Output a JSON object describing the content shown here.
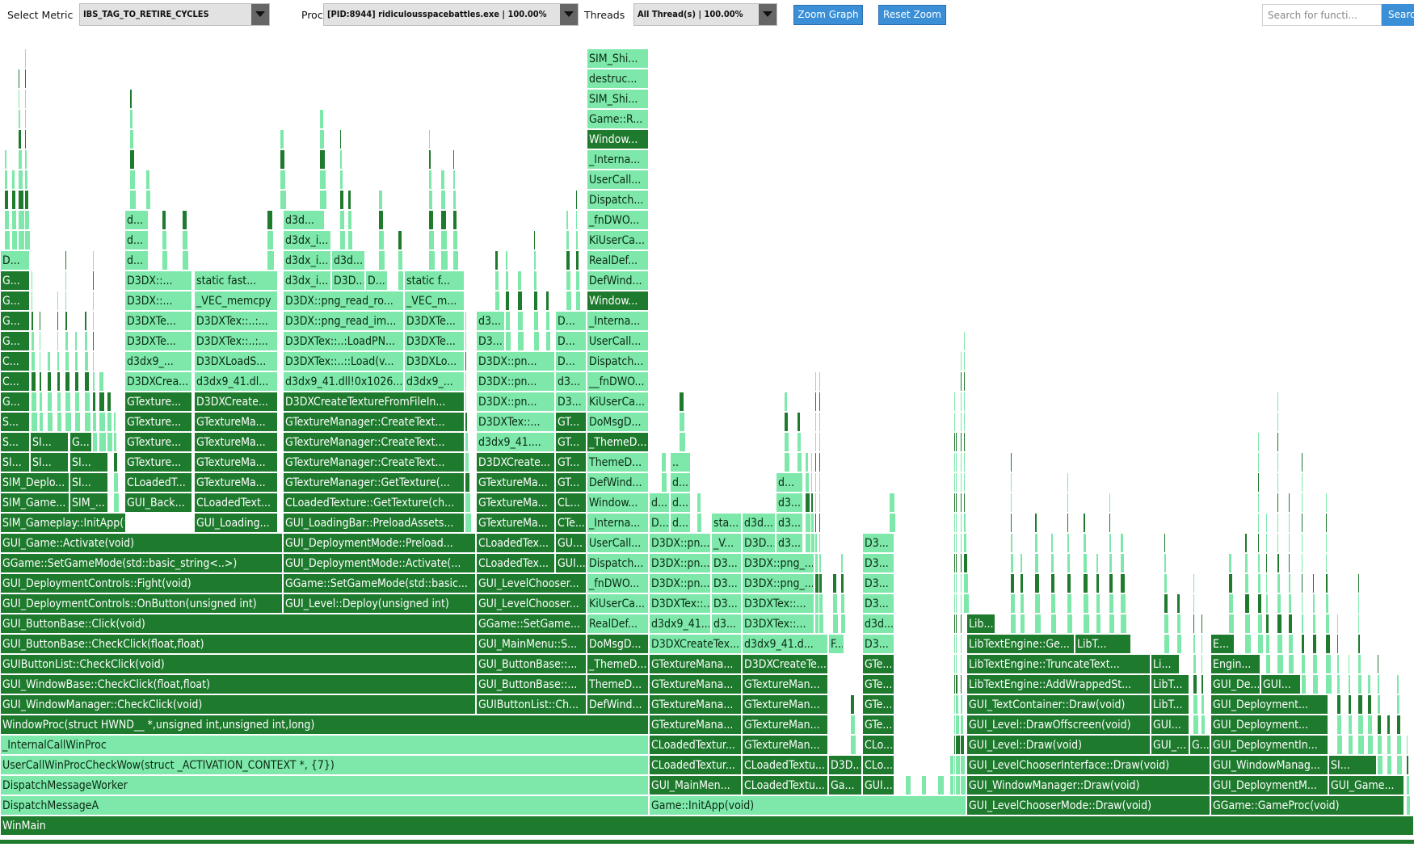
{
  "toolbar": {
    "metric_label": "Select Metric",
    "metric_value": "IBS_TAG_TO_RETIRE_CYCLES",
    "process_label": "Process",
    "process_value": "[PID:8944] ridiculousspacebattles.exe | 100.00%",
    "threads_label": "Threads",
    "threads_value": "All Thread(s) | 100.00%",
    "zoom_graph": "Zoom Graph",
    "reset_zoom": "Reset Zoom",
    "search_placeholder": "Search for functi...",
    "search_button": "Search"
  },
  "colors": {
    "dark": "#1e7a2d",
    "light": "#7de8a9",
    "dark_text": "#ffffff",
    "light_text": "#0b2a14"
  },
  "frames": [
    [
      "WinMain",
      0,
      1750,
      0,
      "d"
    ],
    [
      "DispatchMessageA",
      0,
      803,
      1,
      "l"
    ],
    [
      "Game::InitApp(void)",
      803,
      393,
      1,
      "l"
    ],
    [
      "GUI_LevelChooserMode::Draw(void)",
      1196,
      302,
      1,
      "d"
    ],
    [
      "GGame::GameProc(void)",
      1498,
      240,
      1,
      "d"
    ],
    [
      "DispatchMessageWorker",
      0,
      803,
      2,
      "l"
    ],
    [
      "GUI_MainMen...",
      803,
      115,
      2,
      "d"
    ],
    [
      "CLoadedTextu...",
      918,
      107,
      2,
      "d"
    ],
    [
      "Ga...",
      1025,
      42,
      2,
      "d"
    ],
    [
      "GUI...",
      1067,
      40,
      2,
      "d"
    ],
    [
      "GUI_WindowManager::Draw(void)",
      1196,
      302,
      2,
      "d"
    ],
    [
      "GUI_DeploymentM...",
      1498,
      146,
      2,
      "d"
    ],
    [
      "GUI_Game...",
      1644,
      94,
      2,
      "d"
    ],
    [
      "UserCallWinProcCheckWow(struct _ACTIVATION_CONTEXT *, {7})",
      0,
      803,
      3,
      "l"
    ],
    [
      "CLoadedTextur...",
      803,
      115,
      3,
      "d"
    ],
    [
      "CLoadedTextu...",
      918,
      107,
      3,
      "d"
    ],
    [
      "D3D...",
      1025,
      42,
      3,
      "d"
    ],
    [
      "CLo...",
      1067,
      40,
      3,
      "d"
    ],
    [
      "GUI_LevelChooserInterface::Draw(void)",
      1196,
      302,
      3,
      "d"
    ],
    [
      "GUI_WindowManag...",
      1498,
      146,
      3,
      "d"
    ],
    [
      "SI...",
      1644,
      60,
      3,
      "d"
    ],
    [
      "_InternalCallWinProc",
      0,
      803,
      4,
      "l"
    ],
    [
      "CLoadedTextur...",
      803,
      115,
      4,
      "d"
    ],
    [
      "GTextureMan...",
      918,
      107,
      4,
      "d"
    ],
    [
      "CLo...",
      1067,
      40,
      4,
      "d"
    ],
    [
      "GUI_Level::Draw(void)",
      1196,
      228,
      4,
      "d"
    ],
    [
      "GUI_...",
      1424,
      48,
      4,
      "d"
    ],
    [
      "G...",
      1472,
      26,
      4,
      "d"
    ],
    [
      "GUI_DeploymentIn...",
      1498,
      146,
      4,
      "d"
    ],
    [
      "WindowProc(struct HWND__ *,unsigned int,unsigned int,long)",
      0,
      803,
      5,
      "d"
    ],
    [
      "GTextureMana...",
      803,
      115,
      5,
      "d"
    ],
    [
      "GTextureMan...",
      918,
      107,
      5,
      "d"
    ],
    [
      "GTe...",
      1067,
      40,
      5,
      "d"
    ],
    [
      "GUI_Level::DrawOffscreen(void)",
      1196,
      228,
      5,
      "d"
    ],
    [
      "GUI...",
      1424,
      48,
      5,
      "d"
    ],
    [
      "GUI_Deployment...",
      1498,
      146,
      5,
      "d"
    ],
    [
      "GUI_WindowManager::CheckClick(void)",
      0,
      589,
      6,
      "d"
    ],
    [
      "GUIButtonList::Ch...",
      589,
      137,
      6,
      "d"
    ],
    [
      "DefWind...",
      726,
      77,
      6,
      "d"
    ],
    [
      "GTextureMana...",
      803,
      115,
      6,
      "d"
    ],
    [
      "GTextureMan...",
      918,
      107,
      6,
      "d"
    ],
    [
      "GTe...",
      1067,
      40,
      6,
      "d"
    ],
    [
      "GUI_TextContainer::Draw(void)",
      1196,
      228,
      6,
      "d"
    ],
    [
      "LibT...",
      1424,
      48,
      6,
      "d"
    ],
    [
      "GUI_Deployment...",
      1498,
      146,
      6,
      "d"
    ],
    [
      "GUI_WindowBase::CheckClick(float,float)",
      0,
      589,
      7,
      "d"
    ],
    [
      "GUI_ButtonBase::...",
      589,
      137,
      7,
      "d"
    ],
    [
      "ThemeD...",
      726,
      77,
      7,
      "d"
    ],
    [
      "GTextureMana...",
      803,
      115,
      7,
      "d"
    ],
    [
      "GTextureMan...",
      918,
      107,
      7,
      "d"
    ],
    [
      "GTe...",
      1067,
      40,
      7,
      "d"
    ],
    [
      "LibTextEngine::AddWrappedSt...",
      1196,
      228,
      7,
      "d"
    ],
    [
      "LibT...",
      1424,
      48,
      7,
      "d"
    ],
    [
      "GUI_De...",
      1498,
      62,
      7,
      "d"
    ],
    [
      "GUI...",
      1560,
      50,
      7,
      "d"
    ],
    [
      "GUIButtonList::CheckClick(void)",
      0,
      589,
      8,
      "d"
    ],
    [
      "GUI_ButtonBase::...",
      589,
      137,
      8,
      "d"
    ],
    [
      "_ThemeD...",
      726,
      77,
      8,
      "d"
    ],
    [
      "GTextureMana...",
      803,
      115,
      8,
      "d"
    ],
    [
      "D3DXCreateTe...",
      918,
      107,
      8,
      "d"
    ],
    [
      "GTe...",
      1067,
      40,
      8,
      "d"
    ],
    [
      "LibTextEngine::TruncateText...",
      1196,
      228,
      8,
      "d"
    ],
    [
      "Li...",
      1424,
      36,
      8,
      "d"
    ],
    [
      "Engin...",
      1498,
      62,
      8,
      "d"
    ],
    [
      "GUI_ButtonBase::CheckClick(float,float)",
      0,
      589,
      9,
      "d"
    ],
    [
      "GUI_MainMenu::S...",
      589,
      137,
      9,
      "d"
    ],
    [
      "DoMsgD...",
      726,
      77,
      9,
      "d"
    ],
    [
      "D3DXCreateTex...",
      803,
      115,
      9,
      "l"
    ],
    [
      "d3dx9_41.d...",
      918,
      107,
      9,
      "l"
    ],
    [
      "F...",
      1025,
      20,
      9,
      "l"
    ],
    [
      "D3...",
      1067,
      40,
      9,
      "l"
    ],
    [
      "LibTextEngine::Ge...",
      1196,
      134,
      9,
      "d"
    ],
    [
      "LibT...",
      1330,
      70,
      9,
      "d"
    ],
    [
      "E...",
      1498,
      30,
      9,
      "d"
    ],
    [
      "GUI_ButtonBase::Click(void)",
      0,
      589,
      10,
      "d"
    ],
    [
      "GGame::SetGame...",
      589,
      137,
      10,
      "d"
    ],
    [
      "RealDef...",
      726,
      77,
      10,
      "l"
    ],
    [
      "d3dx9_41...",
      803,
      77,
      10,
      "l"
    ],
    [
      "d3...",
      880,
      38,
      10,
      "l"
    ],
    [
      "D3DXTex::...",
      918,
      90,
      10,
      "l"
    ],
    [
      "d3d...",
      1067,
      40,
      10,
      "l"
    ],
    [
      "Lib...",
      1196,
      36,
      10,
      "d"
    ],
    [
      "GUI_DeploymentControls::OnButton(unsigned int)",
      0,
      350,
      11,
      "d"
    ],
    [
      "GUI_Level::Deploy(unsigned int)",
      350,
      239,
      11,
      "d"
    ],
    [
      "GUI_LevelChooser...",
      589,
      137,
      11,
      "d"
    ],
    [
      "KiUserCa...",
      726,
      77,
      11,
      "l"
    ],
    [
      "D3DXTex::...",
      803,
      77,
      11,
      "l"
    ],
    [
      "D3...",
      880,
      38,
      11,
      "l"
    ],
    [
      "D3DXTex::...",
      918,
      90,
      11,
      "l"
    ],
    [
      "D3...",
      1067,
      40,
      11,
      "l"
    ],
    [
      "GUI_DeploymentControls::Fight(void)",
      0,
      350,
      12,
      "d"
    ],
    [
      "GGame::SetGameMode(std::basic...",
      350,
      239,
      12,
      "d"
    ],
    [
      "GUI_LevelChooser...",
      589,
      137,
      12,
      "d"
    ],
    [
      "_fnDWO...",
      726,
      77,
      12,
      "l"
    ],
    [
      "D3DX::pn...",
      803,
      77,
      12,
      "l"
    ],
    [
      "D3...",
      880,
      38,
      12,
      "l"
    ],
    [
      "D3DX::png_...",
      918,
      90,
      12,
      "l"
    ],
    [
      "D3...",
      1067,
      40,
      12,
      "l"
    ],
    [
      "GGame::SetGameMode(std::basic_string<..>)",
      0,
      350,
      13,
      "d"
    ],
    [
      "GUI_DeploymentMode::Activate(...",
      350,
      239,
      13,
      "d"
    ],
    [
      "CLoadedTex...",
      589,
      98,
      13,
      "d"
    ],
    [
      "GUI...",
      687,
      39,
      13,
      "d"
    ],
    [
      "Dispatch...",
      726,
      77,
      13,
      "l"
    ],
    [
      "D3DX::pn...",
      803,
      77,
      13,
      "l"
    ],
    [
      "D3...",
      880,
      38,
      13,
      "l"
    ],
    [
      "D3DX::png_...",
      918,
      90,
      13,
      "l"
    ],
    [
      "D3...",
      1067,
      40,
      13,
      "l"
    ],
    [
      "GUI_Game::Activate(void)",
      0,
      350,
      14,
      "d"
    ],
    [
      "GUI_DeploymentMode::Preload...",
      350,
      239,
      14,
      "d"
    ],
    [
      "CLoadedTex...",
      589,
      98,
      14,
      "d"
    ],
    [
      "GU...",
      687,
      39,
      14,
      "d"
    ],
    [
      "UserCall...",
      726,
      77,
      14,
      "l"
    ],
    [
      "D3DX::pn...",
      803,
      77,
      14,
      "l"
    ],
    [
      "_V...",
      880,
      38,
      14,
      "l"
    ],
    [
      "D3D...",
      918,
      42,
      14,
      "l"
    ],
    [
      "d3...",
      960,
      34,
      14,
      "l"
    ],
    [
      "D3...",
      1067,
      40,
      14,
      "l"
    ],
    [
      "SIM_Gameplay::InitApp(void)",
      0,
      156,
      15,
      "d"
    ],
    [
      "GUI_Loading...",
      240,
      104,
      15,
      "d"
    ],
    [
      "GUI_LoadingBar::PreloadAssets...",
      350,
      225,
      15,
      "d"
    ],
    [
      "GTextureMa...",
      589,
      98,
      15,
      "d"
    ],
    [
      "CTe...",
      687,
      39,
      15,
      "d"
    ],
    [
      "_Interna...",
      726,
      77,
      15,
      "l"
    ],
    [
      "D...",
      803,
      26,
      15,
      "l"
    ],
    [
      "d...",
      829,
      26,
      15,
      "l"
    ],
    [
      "sta...",
      880,
      38,
      15,
      "l"
    ],
    [
      "d3d...",
      918,
      42,
      15,
      "l"
    ],
    [
      "d3...",
      960,
      34,
      15,
      "l"
    ],
    [
      "SIM_Game...",
      0,
      86,
      16,
      "d"
    ],
    [
      "SIM_...",
      86,
      48,
      16,
      "d"
    ],
    [
      "GUI_Back...",
      154,
      84,
      16,
      "d"
    ],
    [
      "CLoadedText...",
      240,
      104,
      16,
      "d"
    ],
    [
      "CLoadedTexture::GetTexture(ch...",
      350,
      225,
      16,
      "d"
    ],
    [
      "GTextureMa...",
      589,
      98,
      16,
      "d"
    ],
    [
      "CL...",
      687,
      39,
      16,
      "d"
    ],
    [
      "Window...",
      726,
      77,
      16,
      "l"
    ],
    [
      "d...",
      803,
      26,
      16,
      "l"
    ],
    [
      "d...",
      829,
      26,
      16,
      "l"
    ],
    [
      "d3...",
      960,
      34,
      16,
      "l"
    ],
    [
      "SIM_Deplo...",
      0,
      86,
      17,
      "d"
    ],
    [
      "SI...",
      86,
      48,
      17,
      "d"
    ],
    [
      "CLoadedT...",
      154,
      84,
      17,
      "d"
    ],
    [
      "GTextureMa...",
      240,
      104,
      17,
      "d"
    ],
    [
      "GTextureManager::GetTexture(...",
      350,
      225,
      17,
      "d"
    ],
    [
      "GTextureMa...",
      589,
      98,
      17,
      "d"
    ],
    [
      "GT...",
      687,
      39,
      17,
      "d"
    ],
    [
      "DefWind...",
      726,
      77,
      17,
      "l"
    ],
    [
      "d...",
      829,
      26,
      17,
      "l"
    ],
    [
      "d...",
      960,
      34,
      17,
      "l"
    ],
    [
      "SI...",
      0,
      37,
      18,
      "d"
    ],
    [
      "SI...",
      37,
      48,
      18,
      "d"
    ],
    [
      "SI...",
      86,
      48,
      18,
      "d"
    ],
    [
      "GTexture...",
      154,
      84,
      18,
      "d"
    ],
    [
      "GTextureMa...",
      240,
      104,
      18,
      "d"
    ],
    [
      "GTextureManager::CreateText...",
      350,
      225,
      18,
      "d"
    ],
    [
      "D3DXCreate...",
      589,
      98,
      18,
      "d"
    ],
    [
      "GT...",
      687,
      39,
      18,
      "d"
    ],
    [
      "ThemeD...",
      726,
      77,
      18,
      "l"
    ],
    [
      "..",
      829,
      26,
      18,
      "l"
    ],
    [
      "S...",
      0,
      37,
      19,
      "d"
    ],
    [
      "SI...",
      37,
      48,
      19,
      "d"
    ],
    [
      "G...",
      86,
      28,
      19,
      "d"
    ],
    [
      "GTexture...",
      154,
      84,
      19,
      "d"
    ],
    [
      "GTextureMa...",
      240,
      104,
      19,
      "d"
    ],
    [
      "GTextureManager::CreateText...",
      350,
      225,
      19,
      "d"
    ],
    [
      "d3dx9_41....",
      589,
      98,
      19,
      "l"
    ],
    [
      "GT...",
      687,
      39,
      19,
      "d"
    ],
    [
      "_ThemeD...",
      726,
      77,
      19,
      "d"
    ],
    [
      "S...",
      0,
      37,
      20,
      "d"
    ],
    [
      "GTexture...",
      154,
      84,
      20,
      "d"
    ],
    [
      "GTextureMa...",
      240,
      104,
      20,
      "d"
    ],
    [
      "GTextureManager::CreateText...",
      350,
      225,
      20,
      "d"
    ],
    [
      "D3DXTex::...",
      589,
      98,
      20,
      "l"
    ],
    [
      "GT...",
      687,
      39,
      20,
      "d"
    ],
    [
      "DoMsgD...",
      726,
      77,
      20,
      "l"
    ],
    [
      "G...",
      0,
      37,
      21,
      "d"
    ],
    [
      "GTexture...",
      154,
      84,
      21,
      "d"
    ],
    [
      "D3DXCreate...",
      240,
      104,
      21,
      "d"
    ],
    [
      "D3DXCreateTextureFromFileIn...",
      350,
      225,
      21,
      "d"
    ],
    [
      "D3DX::pn...",
      589,
      98,
      21,
      "l"
    ],
    [
      "D3...",
      687,
      39,
      21,
      "l"
    ],
    [
      "KiUserCa...",
      726,
      77,
      21,
      "l"
    ],
    [
      "C...",
      0,
      37,
      22,
      "d"
    ],
    [
      "D3DXCrea...",
      154,
      84,
      22,
      "l"
    ],
    [
      "d3dx9_41.dl...",
      240,
      104,
      22,
      "l"
    ],
    [
      "d3dx9_41.dll!0x1026...",
      350,
      150,
      22,
      "l"
    ],
    [
      "d3dx9_...",
      500,
      75,
      22,
      "l"
    ],
    [
      "D3DX::pn...",
      589,
      98,
      22,
      "l"
    ],
    [
      "d3...",
      687,
      39,
      22,
      "l"
    ],
    [
      "__fnDWO...",
      726,
      77,
      22,
      "l"
    ],
    [
      "C...",
      0,
      37,
      23,
      "d"
    ],
    [
      "d3dx9_...",
      154,
      84,
      23,
      "l"
    ],
    [
      "D3DXLoadS...",
      240,
      104,
      23,
      "l"
    ],
    [
      "D3DXTex::..::Load(v...",
      350,
      150,
      23,
      "l"
    ],
    [
      "D3DXLo...",
      500,
      75,
      23,
      "l"
    ],
    [
      "D3DX::pn...",
      589,
      98,
      23,
      "l"
    ],
    [
      "D...",
      687,
      39,
      23,
      "l"
    ],
    [
      "Dispatch...",
      726,
      77,
      23,
      "l"
    ],
    [
      "G...",
      0,
      37,
      24,
      "d"
    ],
    [
      "D3DXTe...",
      154,
      84,
      24,
      "l"
    ],
    [
      "D3DXTex::..:...",
      240,
      104,
      24,
      "l"
    ],
    [
      "D3DXTex::..:LoadPN...",
      350,
      150,
      24,
      "l"
    ],
    [
      "D3DXTe...",
      500,
      75,
      24,
      "l"
    ],
    [
      "D3...",
      589,
      36,
      24,
      "l"
    ],
    [
      "D...",
      687,
      39,
      24,
      "l"
    ],
    [
      "UserCall...",
      726,
      77,
      24,
      "l"
    ],
    [
      "G...",
      0,
      37,
      25,
      "d"
    ],
    [
      "D3DXTe...",
      154,
      84,
      25,
      "l"
    ],
    [
      "D3DXTex::..:...",
      240,
      104,
      25,
      "l"
    ],
    [
      "D3DX::png_read_im...",
      350,
      150,
      25,
      "l"
    ],
    [
      "D3DXTe...",
      500,
      75,
      25,
      "l"
    ],
    [
      "d3...",
      589,
      36,
      25,
      "l"
    ],
    [
      "D...",
      687,
      39,
      25,
      "l"
    ],
    [
      "_Interna...",
      726,
      77,
      25,
      "l"
    ],
    [
      "G...",
      0,
      37,
      26,
      "d"
    ],
    [
      "D3DX::...",
      154,
      84,
      26,
      "l"
    ],
    [
      "_VEC_memcpy",
      240,
      104,
      26,
      "l"
    ],
    [
      "D3DX::png_read_ro...",
      350,
      150,
      26,
      "l"
    ],
    [
      "_VEC_m...",
      500,
      75,
      26,
      "l"
    ],
    [
      "Window...",
      726,
      77,
      26,
      "d"
    ],
    [
      "G...",
      0,
      37,
      27,
      "d"
    ],
    [
      "D3DX::...",
      154,
      84,
      27,
      "l"
    ],
    [
      "static fast...",
      240,
      104,
      27,
      "l"
    ],
    [
      "d3dx_i...",
      350,
      60,
      27,
      "l"
    ],
    [
      "D3D...",
      410,
      42,
      27,
      "l"
    ],
    [
      "D...",
      452,
      28,
      27,
      "l"
    ],
    [
      "static f...",
      500,
      75,
      27,
      "l"
    ],
    [
      "DefWind...",
      726,
      77,
      27,
      "l"
    ],
    [
      "D...",
      0,
      37,
      28,
      "l"
    ],
    [
      "d...",
      154,
      30,
      28,
      "l"
    ],
    [
      "d3dx_i...",
      350,
      60,
      28,
      "l"
    ],
    [
      "d3d...",
      410,
      42,
      28,
      "l"
    ],
    [
      "RealDef...",
      726,
      77,
      28,
      "l"
    ],
    [
      "d...",
      154,
      30,
      29,
      "l"
    ],
    [
      "d3dx_i...",
      350,
      60,
      29,
      "l"
    ],
    [
      "KiUserCa...",
      726,
      77,
      29,
      "l"
    ],
    [
      "d...",
      154,
      30,
      30,
      "l"
    ],
    [
      "d3d...",
      350,
      52,
      30,
      "l"
    ],
    [
      "_fnDWO...",
      726,
      77,
      30,
      "l"
    ],
    [
      "Dispatch...",
      726,
      77,
      31,
      "l"
    ],
    [
      "UserCall...",
      726,
      77,
      32,
      "l"
    ],
    [
      "_Interna...",
      726,
      77,
      33,
      "l"
    ],
    [
      "Window...",
      726,
      77,
      34,
      "d"
    ],
    [
      "Game::R...",
      726,
      77,
      35,
      "l"
    ],
    [
      "SIM_Shi...",
      726,
      77,
      36,
      "l"
    ],
    [
      "destruc...",
      726,
      77,
      37,
      "l"
    ],
    [
      "SIM_Shi...",
      726,
      77,
      38,
      "l"
    ]
  ]
}
